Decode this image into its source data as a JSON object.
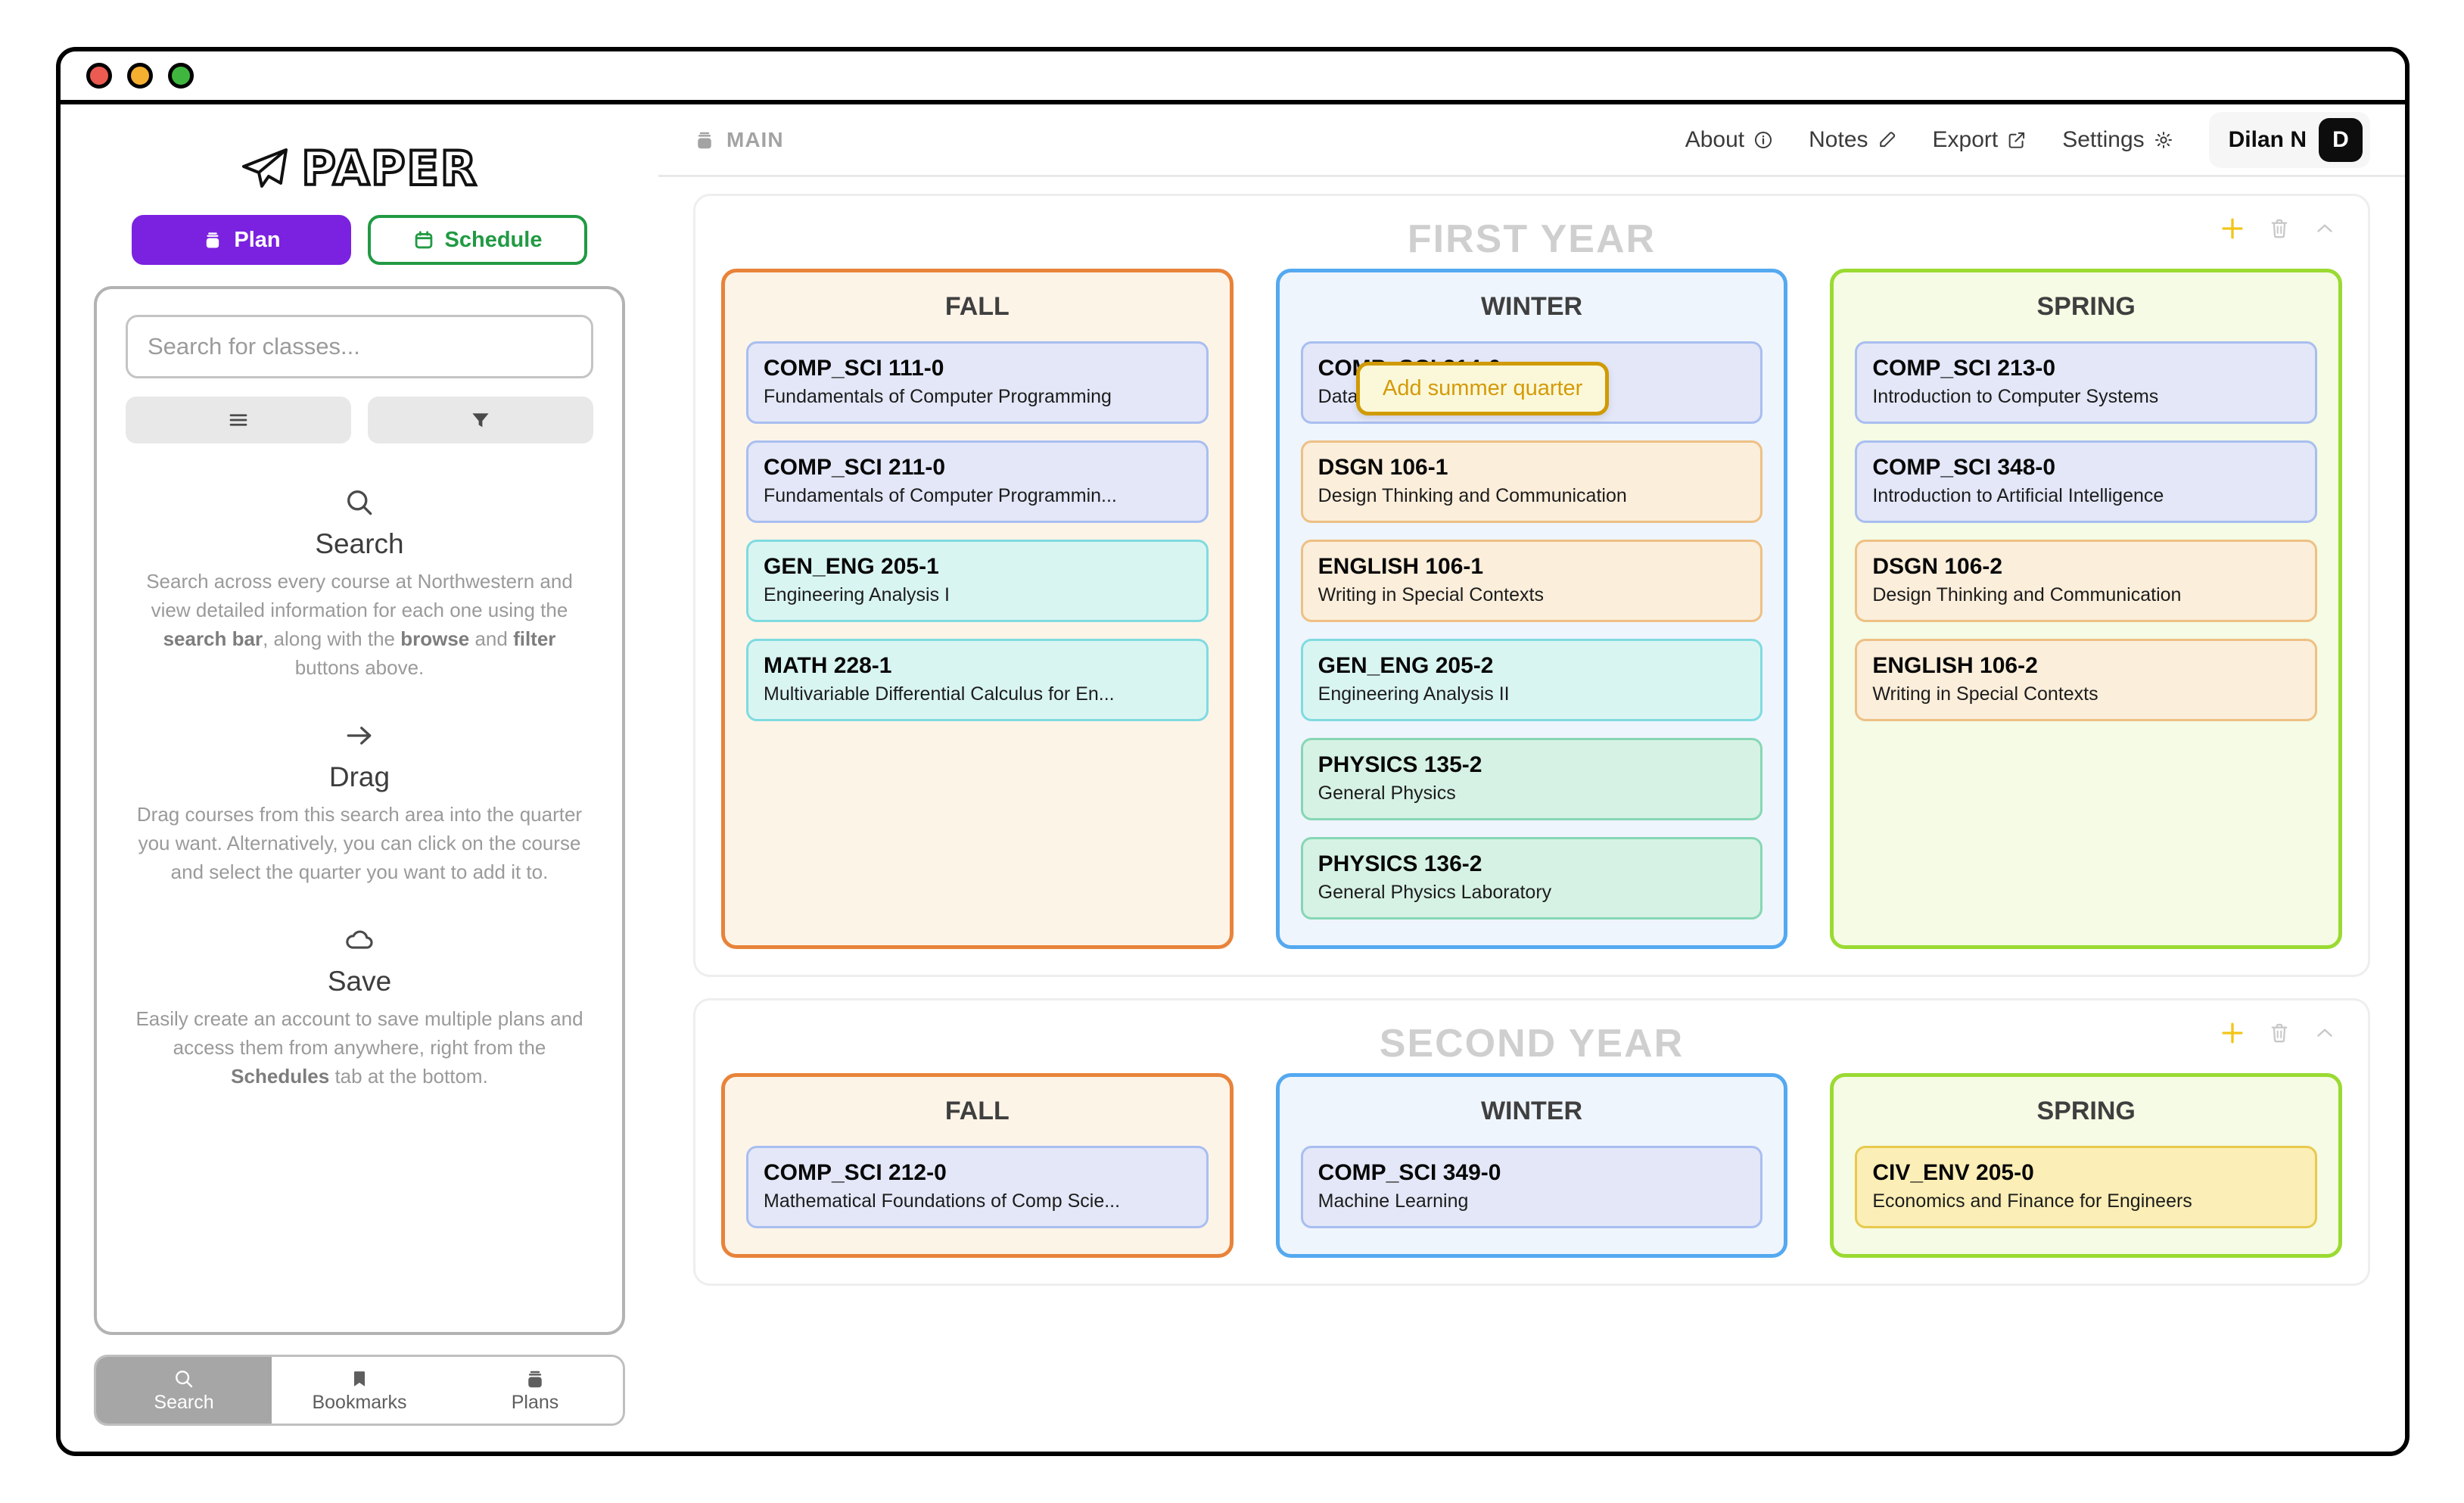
{
  "window": {
    "traffic_lights": [
      "close",
      "minimize",
      "maximize"
    ]
  },
  "sidebar": {
    "brand": "PAPER",
    "mode_buttons": [
      {
        "label": "Plan",
        "icon": "stack-icon",
        "active": true
      },
      {
        "label": "Schedule",
        "icon": "calendar-icon",
        "active": false
      }
    ],
    "search": {
      "placeholder": "Search for classes...",
      "value": "",
      "browse_icon": "list-icon",
      "filter_icon": "funnel-icon"
    },
    "onboarding": [
      {
        "icon": "magnifier-icon",
        "title": "Search",
        "text_parts": [
          {
            "t": "Search across every course at Northwestern and view detailed information for each one using the ",
            "b": false
          },
          {
            "t": "search bar",
            "b": true
          },
          {
            "t": ", along with the ",
            "b": false
          },
          {
            "t": "browse",
            "b": true
          },
          {
            "t": " and ",
            "b": false
          },
          {
            "t": "filter",
            "b": true
          },
          {
            "t": " buttons above.",
            "b": false
          }
        ]
      },
      {
        "icon": "arrow-right-icon",
        "title": "Drag",
        "text_parts": [
          {
            "t": "Drag courses from this search area into the quarter you want. Alternatively, you can click on the course and select the quarter you want to add it to.",
            "b": false
          }
        ]
      },
      {
        "icon": "cloud-icon",
        "title": "Save",
        "text_parts": [
          {
            "t": "Easily create an account to save multiple plans and access them from anywhere, right from the ",
            "b": false
          },
          {
            "t": "Schedules",
            "b": true
          },
          {
            "t": " tab at the bottom.",
            "b": false
          }
        ]
      }
    ],
    "tabs": [
      {
        "label": "Search",
        "icon": "magnifier-icon",
        "active": true
      },
      {
        "label": "Bookmarks",
        "icon": "bookmark-icon",
        "active": false
      },
      {
        "label": "Plans",
        "icon": "stack-icon",
        "active": false
      }
    ]
  },
  "topbar": {
    "plan_name": "MAIN",
    "plan_icon": "stack-icon",
    "nav": [
      {
        "label": "About",
        "icon": "info-icon"
      },
      {
        "label": "Notes",
        "icon": "edit-icon"
      },
      {
        "label": "Export",
        "icon": "external-link-icon"
      },
      {
        "label": "Settings",
        "icon": "gear-icon"
      }
    ],
    "user": {
      "name": "Dilan N",
      "initial": "D"
    }
  },
  "tooltip": {
    "text": "Add summer quarter"
  },
  "colors": {
    "accent_plan": "#7b22e0",
    "accent_schedule": "#219a43",
    "fall_border": "#e8833a",
    "fall_bg": "#fdf4e8",
    "winter_border": "#54a9f0",
    "winter_bg": "#eff5fd",
    "spring_border": "#9ada32",
    "spring_bg": "#f5fbe4",
    "add_icon": "#f2c518",
    "tooltip_border": "#d09a05",
    "tooltip_bg": "#fbf8d9"
  },
  "course_colors": {
    "comp_sci": {
      "bg": "#e3e7f7",
      "border": "#a9bef0"
    },
    "gen_eng": {
      "bg": "#d9f5f2",
      "border": "#7fdbe0"
    },
    "math": {
      "bg": "#d9f5f2",
      "border": "#7fdbe0"
    },
    "dsgn": {
      "bg": "#fbeedb",
      "border": "#eec084"
    },
    "english": {
      "bg": "#fbeedb",
      "border": "#eec084"
    },
    "physics": {
      "bg": "#d6f2e4",
      "border": "#86d7b4"
    },
    "civ_env": {
      "bg": "#fbeeb6",
      "border": "#e8c94e"
    }
  },
  "years": [
    {
      "title": "FIRST YEAR",
      "tools": [
        "add-quarter",
        "delete-year",
        "collapse-year"
      ],
      "quarters": [
        {
          "name": "FALL",
          "theme": "fall",
          "courses": [
            {
              "code": "COMP_SCI 111-0",
              "name": "Fundamentals of Computer Programming",
              "subject": "comp_sci"
            },
            {
              "code": "COMP_SCI 211-0",
              "name": "Fundamentals of Computer Programmin...",
              "subject": "comp_sci"
            },
            {
              "code": "GEN_ENG 205-1",
              "name": "Engineering Analysis I",
              "subject": "gen_eng"
            },
            {
              "code": "MATH 228-1",
              "name": "Multivariable Differential Calculus for En...",
              "subject": "math"
            }
          ]
        },
        {
          "name": "WINTER",
          "theme": "winter",
          "courses": [
            {
              "code": "COMP_SCI 214-0",
              "name": "Data Structures & Algorithms",
              "subject": "comp_sci"
            },
            {
              "code": "DSGN 106-1",
              "name": "Design Thinking and Communication",
              "subject": "dsgn"
            },
            {
              "code": "ENGLISH 106-1",
              "name": "Writing in Special Contexts",
              "subject": "english"
            },
            {
              "code": "GEN_ENG 205-2",
              "name": "Engineering Analysis II",
              "subject": "gen_eng"
            },
            {
              "code": "PHYSICS 135-2",
              "name": "General Physics",
              "subject": "physics"
            },
            {
              "code": "PHYSICS 136-2",
              "name": "General Physics Laboratory",
              "subject": "physics"
            }
          ]
        },
        {
          "name": "SPRING",
          "theme": "spring",
          "courses": [
            {
              "code": "COMP_SCI 213-0",
              "name": "Introduction to Computer Systems",
              "subject": "comp_sci"
            },
            {
              "code": "COMP_SCI 348-0",
              "name": "Introduction to Artificial Intelligence",
              "subject": "comp_sci"
            },
            {
              "code": "DSGN 106-2",
              "name": "Design Thinking and Communication",
              "subject": "dsgn"
            },
            {
              "code": "ENGLISH 106-2",
              "name": "Writing in Special Contexts",
              "subject": "english"
            }
          ]
        }
      ]
    },
    {
      "title": "SECOND YEAR",
      "tools": [
        "add-quarter",
        "delete-year",
        "collapse-year"
      ],
      "quarters": [
        {
          "name": "FALL",
          "theme": "fall",
          "courses": [
            {
              "code": "COMP_SCI 212-0",
              "name": "Mathematical Foundations of Comp Scie...",
              "subject": "comp_sci"
            }
          ]
        },
        {
          "name": "WINTER",
          "theme": "winter",
          "courses": [
            {
              "code": "COMP_SCI 349-0",
              "name": "Machine Learning",
              "subject": "comp_sci"
            }
          ]
        },
        {
          "name": "SPRING",
          "theme": "spring",
          "courses": [
            {
              "code": "CIV_ENV 205-0",
              "name": "Economics and Finance for Engineers",
              "subject": "civ_env"
            }
          ]
        }
      ]
    }
  ]
}
